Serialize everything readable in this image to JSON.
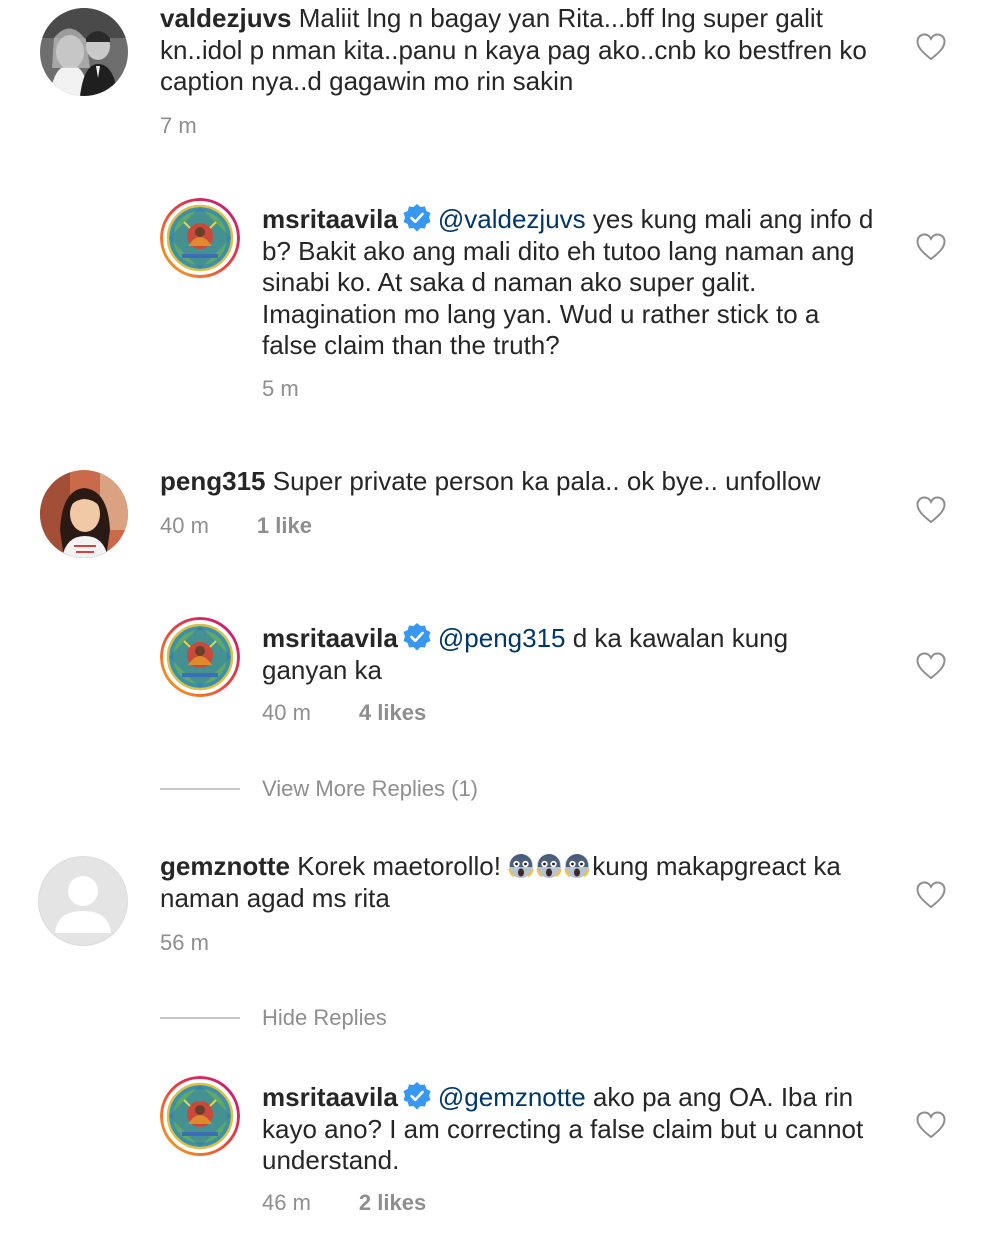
{
  "comments": [
    {
      "username": "valdezjuvs",
      "text": "Maliit lng n bagay yan Rita...bff lng super galit kn..idol p nman kita..panu n kaya pag ako..cnb ko bestfren ko caption nya..d gagawin mo rin sakin",
      "time": "7 m",
      "avatar_icon": "wedding-photo-avatar",
      "reply": {
        "username": "msritaavila",
        "verified_icon": "verified-badge-icon",
        "mention": "@valdezjuvs",
        "text": "yes kung mali ang info d b? Bakit ako ang mali dito eh tutoo lang naman ang sinabi ko. At saka d naman ako super galit. Imagination mo lang yan. Wud u rather stick to a false claim than the truth?",
        "time": "5 m"
      }
    },
    {
      "username": "peng315",
      "text": "Super private person ka pala.. ok bye.. unfollow",
      "time": "40 m",
      "likes": "1 like",
      "avatar_icon": "woman-photo-avatar",
      "reply": {
        "username": "msritaavila",
        "verified_icon": "verified-badge-icon",
        "mention": "@peng315",
        "text": "d ka kawalan kung ganyan ka",
        "time": "40 m",
        "likes": "4 likes"
      },
      "thread_toggle": "View More Replies (1)"
    },
    {
      "username": "gemznotte",
      "text": "Korek maetorollo!",
      "emoji_icon": "screaming-face-emoji",
      "text_after": "kung makapgreact ka naman agad ms rita",
      "time": "56 m",
      "avatar_icon": "default-avatar",
      "thread_toggle": "Hide Replies",
      "reply": {
        "username": "msritaavila",
        "verified_icon": "verified-badge-icon",
        "mention": "@gemznotte",
        "text": "ako pa ang OA. Iba rin kayo ano? I am correcting a false claim but u cannot understand.",
        "time": "46 m",
        "likes": "2 likes"
      }
    }
  ],
  "colors": {
    "text": "#262626",
    "meta": "#8e8e8e",
    "mention": "#00376b",
    "verified": "#3897f0",
    "story_ring_start": "#f9a81a",
    "story_ring_end": "#c4127f"
  }
}
